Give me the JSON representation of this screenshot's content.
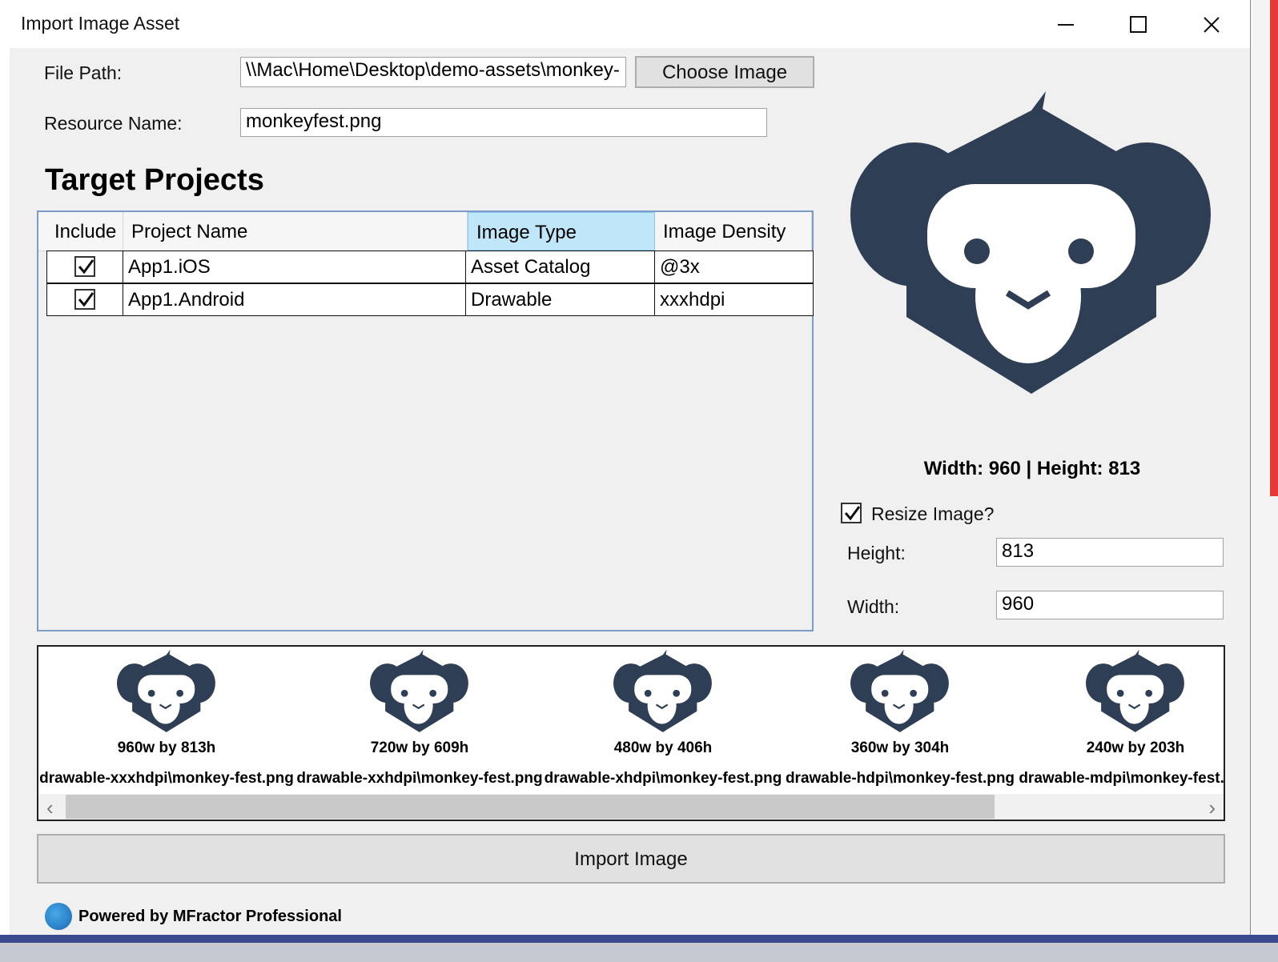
{
  "window": {
    "title": "Import Image Asset"
  },
  "form": {
    "file_path_label": "File Path:",
    "file_path_value": "\\\\Mac\\Home\\Desktop\\demo-assets\\monkey-",
    "choose_button": "Choose Image",
    "resource_name_label": "Resource Name:",
    "resource_name_value": "monkeyfest.png"
  },
  "projects": {
    "title": "Target Projects",
    "columns": [
      "Include",
      "Project Name",
      "Image Type",
      "Image Density"
    ],
    "rows": [
      {
        "include": true,
        "name": "App1.iOS",
        "type": "Asset Catalog",
        "density": "@3x"
      },
      {
        "include": true,
        "name": "App1.Android",
        "type": "Drawable",
        "density": "xxxhdpi"
      }
    ]
  },
  "preview": {
    "dims": "Width: 960 | Height: 813",
    "resize_label": "Resize Image?",
    "resize_checked": true,
    "height_label": "Height:",
    "height_value": "813",
    "width_label": "Width:",
    "width_value": "960",
    "logo_color": "#2e3e54"
  },
  "outputs": [
    {
      "size": "960w by 813h",
      "file": "drawable-xxxhdpi\\monkey-fest.png"
    },
    {
      "size": "720w by 609h",
      "file": "drawable-xxhdpi\\monkey-fest.png"
    },
    {
      "size": "480w by 406h",
      "file": "drawable-xhdpi\\monkey-fest.png"
    },
    {
      "size": "360w by 304h",
      "file": "drawable-hdpi\\monkey-fest.png"
    },
    {
      "size": "240w by 203h",
      "file": "drawable-mdpi\\monkey-fest.png"
    }
  ],
  "actions": {
    "import_button": "Import Image"
  },
  "footer": {
    "text": "Powered by MFractor Professional"
  }
}
